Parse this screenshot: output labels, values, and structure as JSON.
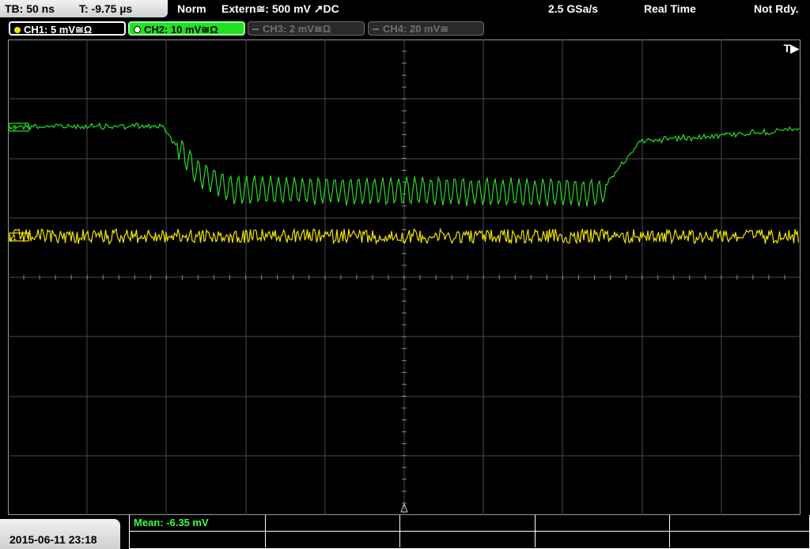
{
  "topbar": {
    "timebase": "TB: 50 ns",
    "trigger_time": "T: -9.75 µs",
    "trigger_mode": "Norm",
    "trigger_source": "Extern≅: 500 mV ↗DC",
    "sample_rate": "2.5 GSa/s",
    "acq_mode": "Real Time",
    "status": "Not Rdy."
  },
  "channels": [
    {
      "label": "CH1: 5 mV≅Ω",
      "color": "#f3e600"
    },
    {
      "label": "CH2: 10 mV≅Ω",
      "color": "#22e022"
    },
    {
      "label": "CH3: 2 mV≅Ω",
      "color": "#707070"
    },
    {
      "label": "CH4: 20 mV≅",
      "color": "#707070"
    }
  ],
  "screen": {
    "trigger_marker": "T▶",
    "ch1_ref": "1",
    "ch2_ref": "2"
  },
  "footer": {
    "datetime": "2015-06-11 23:18",
    "measurement": "Mean: -6.35 mV"
  }
}
